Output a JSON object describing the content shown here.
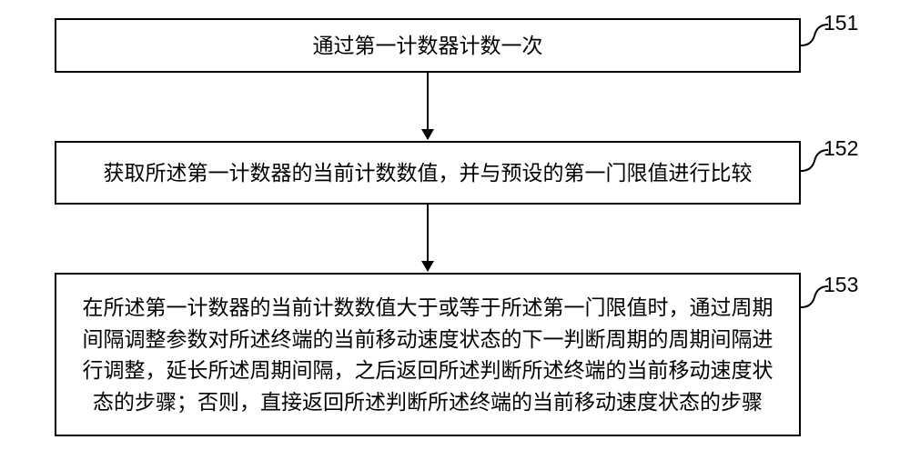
{
  "chart_data": {
    "type": "flowchart",
    "nodes": [
      {
        "id": "151",
        "text": "通过第一计数器计数一次"
      },
      {
        "id": "152",
        "text": "获取所述第一计数器的当前计数数值，并与预设的第一门限值进行比较"
      },
      {
        "id": "153",
        "text": "在所述第一计数器的当前计数数值大于或等于所述第一门限值时，通过周期间隔调整参数对所述终端的当前移动速度状态的下一判断周期的周期间隔进行调整，延长所述周期间隔，之后返回所述判断所述终端的当前移动速度状态的步骤；否则，直接返回所述判断所述终端的当前移动速度状态的步骤"
      }
    ],
    "edges": [
      {
        "from": "151",
        "to": "152"
      },
      {
        "from": "152",
        "to": "153"
      }
    ]
  }
}
